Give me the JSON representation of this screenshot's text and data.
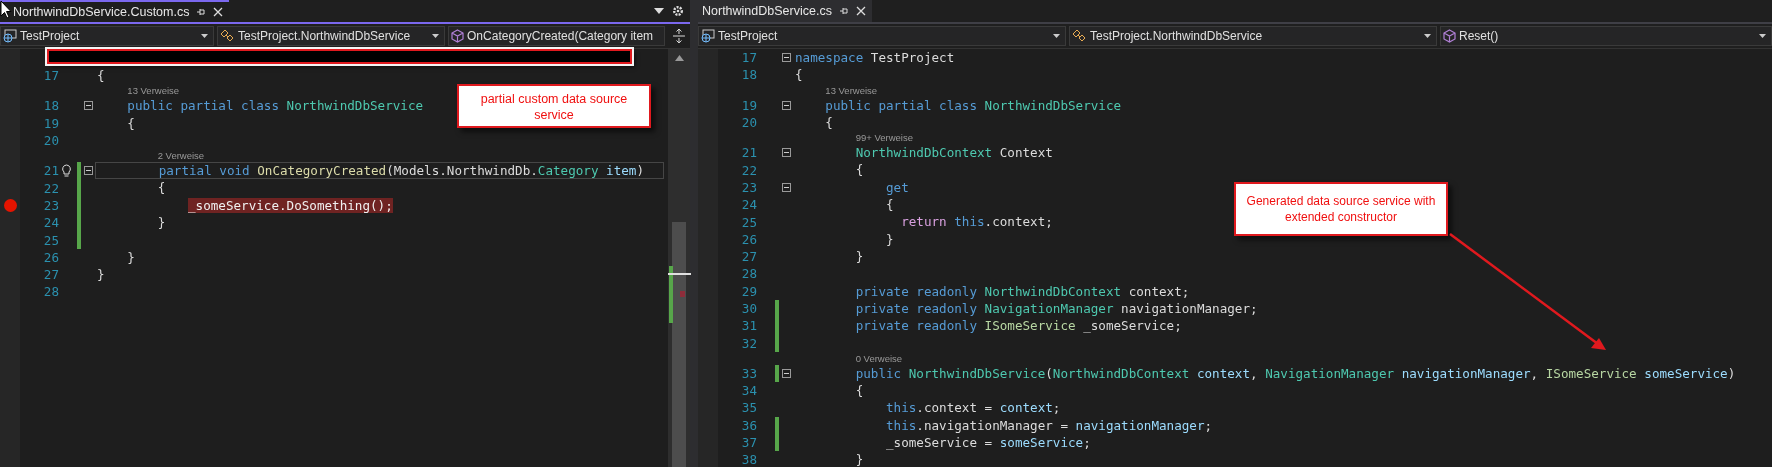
{
  "panes": [
    {
      "tab": {
        "label": "NorthwindDbService.Custom.cs",
        "selected": true
      },
      "menu_icons": true,
      "split_icon": true,
      "redacted": true,
      "scrollbar": true,
      "nav": [
        {
          "label": "TestProject",
          "kind": "project"
        },
        {
          "label": "TestProject.NorthwindDbService",
          "kind": "class"
        },
        {
          "label": "OnCategoryCreated(Category item",
          "kind": "member"
        }
      ],
      "callout": {
        "text": "partial custom data source service",
        "arrow": false
      },
      "lines": [
        {
          "kind": "code",
          "number": "17",
          "changed": false,
          "foldable": false,
          "tokens": [
            {
              "text": "{",
              "kind": "plain"
            }
          ]
        },
        {
          "kind": "codelens",
          "text": "    13 Verweise"
        },
        {
          "kind": "code",
          "number": "18",
          "changed": false,
          "foldable": true,
          "tokens": [
            {
              "text": "    public partial class",
              "kind": "keyword"
            },
            {
              "text": " NorthwindDbService",
              "kind": "type"
            }
          ]
        },
        {
          "kind": "code",
          "number": "19",
          "changed": false,
          "foldable": false,
          "tokens": [
            {
              "text": "    {",
              "kind": "plain"
            }
          ]
        },
        {
          "kind": "code",
          "number": "20",
          "changed": false,
          "foldable": false
        },
        {
          "kind": "codelens",
          "text": "        2 Verweise"
        },
        {
          "kind": "code",
          "number": "21",
          "changed": true,
          "foldable": true,
          "current": true,
          "lightbulb": true,
          "tokens": [
            {
              "text": "        partial void",
              "kind": "keyword"
            },
            {
              "text": " OnCategoryCreated",
              "kind": "method"
            },
            {
              "text": "(Models.NorthwindDb.",
              "kind": "plain"
            },
            {
              "text": "Category",
              "kind": "type"
            },
            {
              "text": " item",
              "kind": "param"
            },
            {
              "text": ")",
              "kind": "plain"
            }
          ]
        },
        {
          "kind": "code",
          "number": "22",
          "changed": true,
          "foldable": false,
          "tokens": [
            {
              "text": "        {",
              "kind": "plain"
            }
          ]
        },
        {
          "kind": "code",
          "number": "23",
          "changed": true,
          "foldable": false,
          "breakpoint": true,
          "tokens": [
            {
              "text": "            _someService.DoSomething();",
              "kind": "plain"
            }
          ]
        },
        {
          "kind": "code",
          "number": "24",
          "changed": true,
          "foldable": false,
          "tokens": [
            {
              "text": "        }",
              "kind": "plain"
            }
          ]
        },
        {
          "kind": "code",
          "number": "25",
          "changed": true,
          "foldable": false
        },
        {
          "kind": "code",
          "number": "26",
          "changed": false,
          "foldable": false,
          "tokens": [
            {
              "text": "    }",
              "kind": "plain"
            }
          ]
        },
        {
          "kind": "code",
          "number": "27",
          "changed": false,
          "foldable": false,
          "tokens": [
            {
              "text": "}",
              "kind": "plain"
            }
          ]
        },
        {
          "kind": "code",
          "number": "28",
          "changed": false,
          "foldable": false
        }
      ]
    },
    {
      "tab": {
        "label": "NorthwindDbService.cs",
        "selected": false
      },
      "menu_icons": false,
      "split_icon": false,
      "redacted": false,
      "scrollbar": false,
      "nav": [
        {
          "label": "TestProject",
          "kind": "project"
        },
        {
          "label": "TestProject.NorthwindDbService",
          "kind": "class"
        },
        {
          "label": "Reset()",
          "kind": "member"
        }
      ],
      "callout": {
        "text": "Generated data source service with extended constructor",
        "arrow": true
      },
      "lines": [
        {
          "kind": "code",
          "number": "17",
          "changed": false,
          "foldable": true,
          "tokens": [
            {
              "text": "namespace",
              "kind": "keyword"
            },
            {
              "text": " TestProject",
              "kind": "plain"
            }
          ]
        },
        {
          "kind": "code",
          "number": "18",
          "changed": false,
          "foldable": false,
          "tokens": [
            {
              "text": "{",
              "kind": "plain"
            }
          ]
        },
        {
          "kind": "codelens",
          "text": "    13 Verweise"
        },
        {
          "kind": "code",
          "number": "19",
          "changed": false,
          "foldable": true,
          "tokens": [
            {
              "text": "    public partial class",
              "kind": "keyword"
            },
            {
              "text": " NorthwindDbService",
              "kind": "type"
            }
          ]
        },
        {
          "kind": "code",
          "number": "20",
          "changed": false,
          "foldable": false,
          "tokens": [
            {
              "text": "    {",
              "kind": "plain"
            }
          ]
        },
        {
          "kind": "codelens",
          "text": "        99+ Verweise"
        },
        {
          "kind": "code",
          "number": "21",
          "changed": false,
          "foldable": true,
          "tokens": [
            {
              "text": "        NorthwindDbContext",
              "kind": "type"
            },
            {
              "text": " Context",
              "kind": "plain"
            }
          ]
        },
        {
          "kind": "code",
          "number": "22",
          "changed": false,
          "foldable": false,
          "tokens": [
            {
              "text": "        {",
              "kind": "plain"
            }
          ]
        },
        {
          "kind": "code",
          "number": "23",
          "changed": false,
          "foldable": true,
          "tokens": [
            {
              "text": "            get",
              "kind": "keyword"
            }
          ]
        },
        {
          "kind": "code",
          "number": "24",
          "changed": false,
          "foldable": false,
          "tokens": [
            {
              "text": "            {",
              "kind": "plain"
            }
          ]
        },
        {
          "kind": "code",
          "number": "25",
          "changed": false,
          "foldable": false,
          "tokens": [
            {
              "text": "              return",
              "kind": "control"
            },
            {
              "text": " this",
              "kind": "keyword"
            },
            {
              "text": ".context;",
              "kind": "plain"
            }
          ]
        },
        {
          "kind": "code",
          "number": "26",
          "changed": false,
          "foldable": false,
          "tokens": [
            {
              "text": "            }",
              "kind": "plain"
            }
          ]
        },
        {
          "kind": "code",
          "number": "27",
          "changed": false,
          "foldable": false,
          "tokens": [
            {
              "text": "        }",
              "kind": "plain"
            }
          ]
        },
        {
          "kind": "code",
          "number": "28",
          "changed": false,
          "foldable": false
        },
        {
          "kind": "code",
          "number": "29",
          "changed": false,
          "foldable": false,
          "tokens": [
            {
              "text": "        private readonly",
              "kind": "keyword"
            },
            {
              "text": " NorthwindDbContext",
              "kind": "type"
            },
            {
              "text": " context;",
              "kind": "plain"
            }
          ]
        },
        {
          "kind": "code",
          "number": "30",
          "changed": true,
          "foldable": false,
          "tokens": [
            {
              "text": "        private readonly",
              "kind": "keyword"
            },
            {
              "text": " NavigationManager",
              "kind": "type"
            },
            {
              "text": " navigationManager;",
              "kind": "plain"
            }
          ]
        },
        {
          "kind": "code",
          "number": "31",
          "changed": true,
          "foldable": false,
          "tokens": [
            {
              "text": "        private readonly",
              "kind": "keyword"
            },
            {
              "text": " ISomeService",
              "kind": "iface"
            },
            {
              "text": " _someService;",
              "kind": "plain"
            }
          ]
        },
        {
          "kind": "code",
          "number": "32",
          "changed": true,
          "foldable": false
        },
        {
          "kind": "codelens",
          "text": "        0 Verweise"
        },
        {
          "kind": "code",
          "number": "33",
          "changed": true,
          "foldable": true,
          "tokens": [
            {
              "text": "        public",
              "kind": "keyword"
            },
            {
              "text": " NorthwindDbService",
              "kind": "type"
            },
            {
              "text": "(",
              "kind": "plain"
            },
            {
              "text": "NorthwindDbContext",
              "kind": "type"
            },
            {
              "text": " context",
              "kind": "param"
            },
            {
              "text": ", ",
              "kind": "plain"
            },
            {
              "text": "NavigationManager",
              "kind": "type"
            },
            {
              "text": " navigationManager",
              "kind": "param"
            },
            {
              "text": ", ",
              "kind": "plain"
            },
            {
              "text": "ISomeService",
              "kind": "iface"
            },
            {
              "text": " someService",
              "kind": "param"
            },
            {
              "text": ")",
              "kind": "plain"
            }
          ]
        },
        {
          "kind": "code",
          "number": "34",
          "changed": false,
          "foldable": false,
          "tokens": [
            {
              "text": "        {",
              "kind": "plain"
            }
          ]
        },
        {
          "kind": "code",
          "number": "35",
          "changed": false,
          "foldable": false,
          "tokens": [
            {
              "text": "            this",
              "kind": "keyword"
            },
            {
              "text": ".context = ",
              "kind": "plain"
            },
            {
              "text": "context",
              "kind": "param"
            },
            {
              "text": ";",
              "kind": "plain"
            }
          ]
        },
        {
          "kind": "code",
          "number": "36",
          "changed": true,
          "foldable": false,
          "tokens": [
            {
              "text": "            this",
              "kind": "keyword"
            },
            {
              "text": ".navigationManager = ",
              "kind": "plain"
            },
            {
              "text": "navigationManager",
              "kind": "param"
            },
            {
              "text": ";",
              "kind": "plain"
            }
          ]
        },
        {
          "kind": "code",
          "number": "37",
          "changed": true,
          "foldable": false,
          "tokens": [
            {
              "text": "            _someService = ",
              "kind": "plain"
            },
            {
              "text": "someService",
              "kind": "param"
            },
            {
              "text": ";",
              "kind": "plain"
            }
          ]
        },
        {
          "kind": "code",
          "number": "38",
          "changed": false,
          "foldable": false,
          "tokens": [
            {
              "text": "        }",
              "kind": "plain"
            }
          ]
        }
      ]
    }
  ]
}
